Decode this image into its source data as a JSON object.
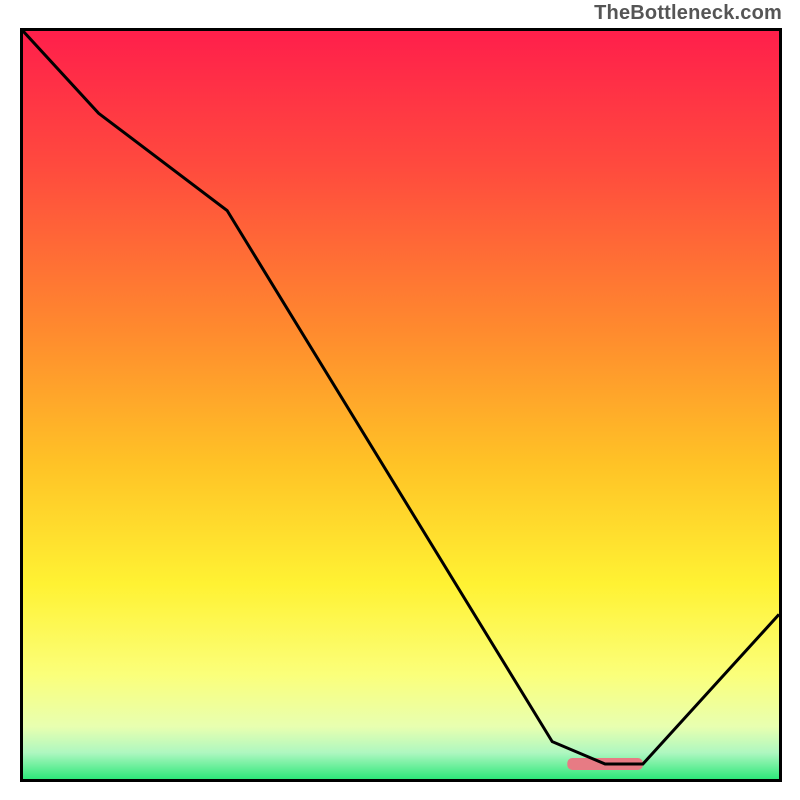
{
  "watermark": "TheBottleneck.com",
  "chart_data": {
    "type": "line",
    "title": "",
    "xlabel": "",
    "ylabel": "",
    "xlim": [
      0,
      100
    ],
    "ylim": [
      0,
      100
    ],
    "series": [
      {
        "name": "curve",
        "x": [
          0,
          10,
          27,
          70,
          77,
          82,
          100
        ],
        "y": [
          100,
          89,
          76,
          5,
          2,
          2,
          22
        ]
      }
    ],
    "marker": {
      "x_start": 72,
      "x_end": 82,
      "y": 2,
      "color": "#e77b84"
    },
    "background_gradient": {
      "stops": [
        {
          "pos": 0.0,
          "color": "#ff1f4b"
        },
        {
          "pos": 0.18,
          "color": "#ff4a3e"
        },
        {
          "pos": 0.4,
          "color": "#ff8a2e"
        },
        {
          "pos": 0.58,
          "color": "#ffc326"
        },
        {
          "pos": 0.74,
          "color": "#fff233"
        },
        {
          "pos": 0.86,
          "color": "#fbff7a"
        },
        {
          "pos": 0.93,
          "color": "#e8ffb0"
        },
        {
          "pos": 0.965,
          "color": "#aef7c0"
        },
        {
          "pos": 1.0,
          "color": "#2ee87a"
        }
      ]
    }
  }
}
